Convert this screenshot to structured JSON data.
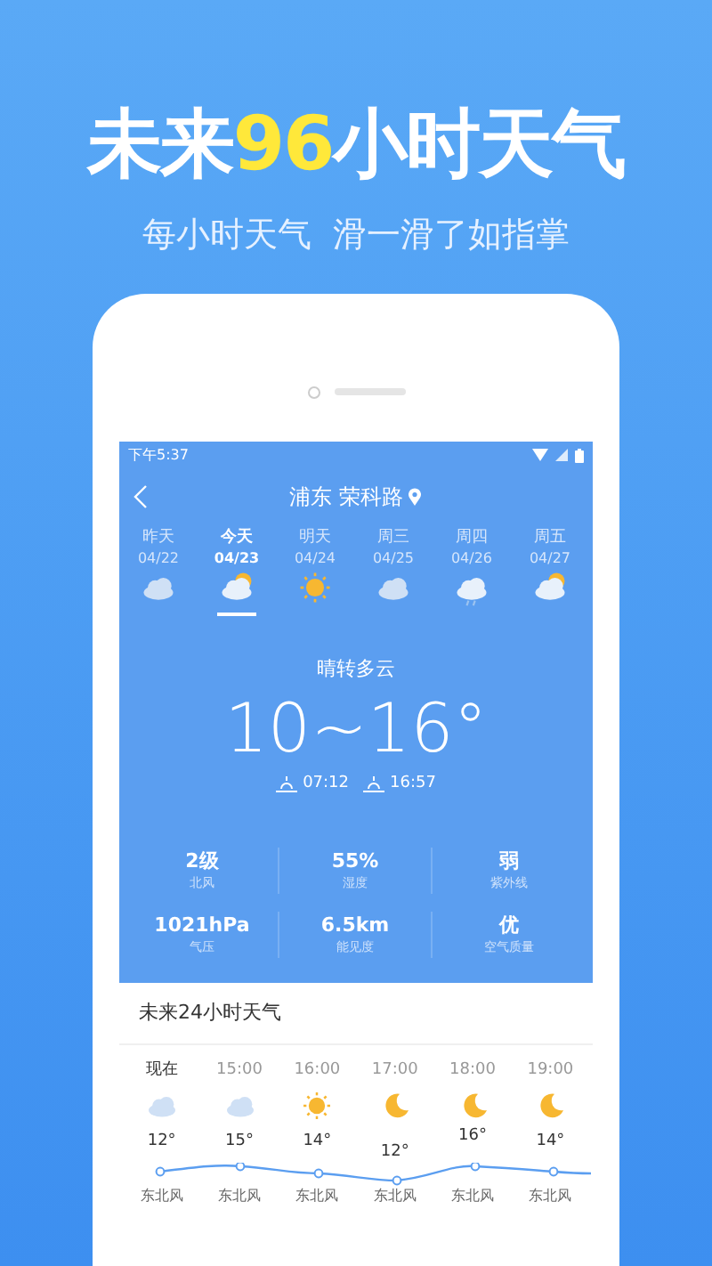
{
  "headline": [
    {
      "text": "未来",
      "highlight": false
    },
    {
      "text": "96",
      "highlight": true
    },
    {
      "text": "小时天气",
      "highlight": false
    }
  ],
  "subtitle": "每小时天气  滑一滑了如指掌",
  "status_bar": {
    "time": "下午5:37"
  },
  "header": {
    "location": "浦东 荣科路"
  },
  "days": [
    {
      "label": "昨天",
      "date": "04/22",
      "kind": "cloud",
      "selected": false
    },
    {
      "label": "今天",
      "date": "04/23",
      "kind": "partly",
      "selected": true
    },
    {
      "label": "明天",
      "date": "04/24",
      "kind": "sun",
      "selected": false
    },
    {
      "label": "周三",
      "date": "04/25",
      "kind": "cloud",
      "selected": false
    },
    {
      "label": "周四",
      "date": "04/26",
      "kind": "rain",
      "selected": false
    },
    {
      "label": "周五",
      "date": "04/27",
      "kind": "partly",
      "selected": false
    }
  ],
  "today": {
    "condition": "晴转多云",
    "temperature": "10~16°",
    "sunrise": "07:12",
    "sunset": "16:57"
  },
  "stats": [
    {
      "value": "2级",
      "label": "北风"
    },
    {
      "value": "55%",
      "label": "湿度"
    },
    {
      "value": "弱",
      "label": "紫外线"
    },
    {
      "value": "1021hPa",
      "label": "气压"
    },
    {
      "value": "6.5km",
      "label": "能见度"
    },
    {
      "value": "优",
      "label": "空气质量"
    }
  ],
  "hourly": {
    "title": "未来24小时天气",
    "items": [
      {
        "time": "现在",
        "kind": "cloud",
        "temp": "12°",
        "wind": "东北风"
      },
      {
        "time": "15:00",
        "kind": "cloud",
        "temp": "15°",
        "wind": "东北风"
      },
      {
        "time": "16:00",
        "kind": "sun",
        "temp": "14°",
        "wind": "东北风"
      },
      {
        "time": "17:00",
        "kind": "moon",
        "temp": "12°",
        "wind": "东北风"
      },
      {
        "time": "18:00",
        "kind": "moon",
        "temp": "16°",
        "wind": "东北风"
      },
      {
        "time": "19:00",
        "kind": "moon",
        "temp": "14°",
        "wind": "东北风"
      }
    ]
  }
}
